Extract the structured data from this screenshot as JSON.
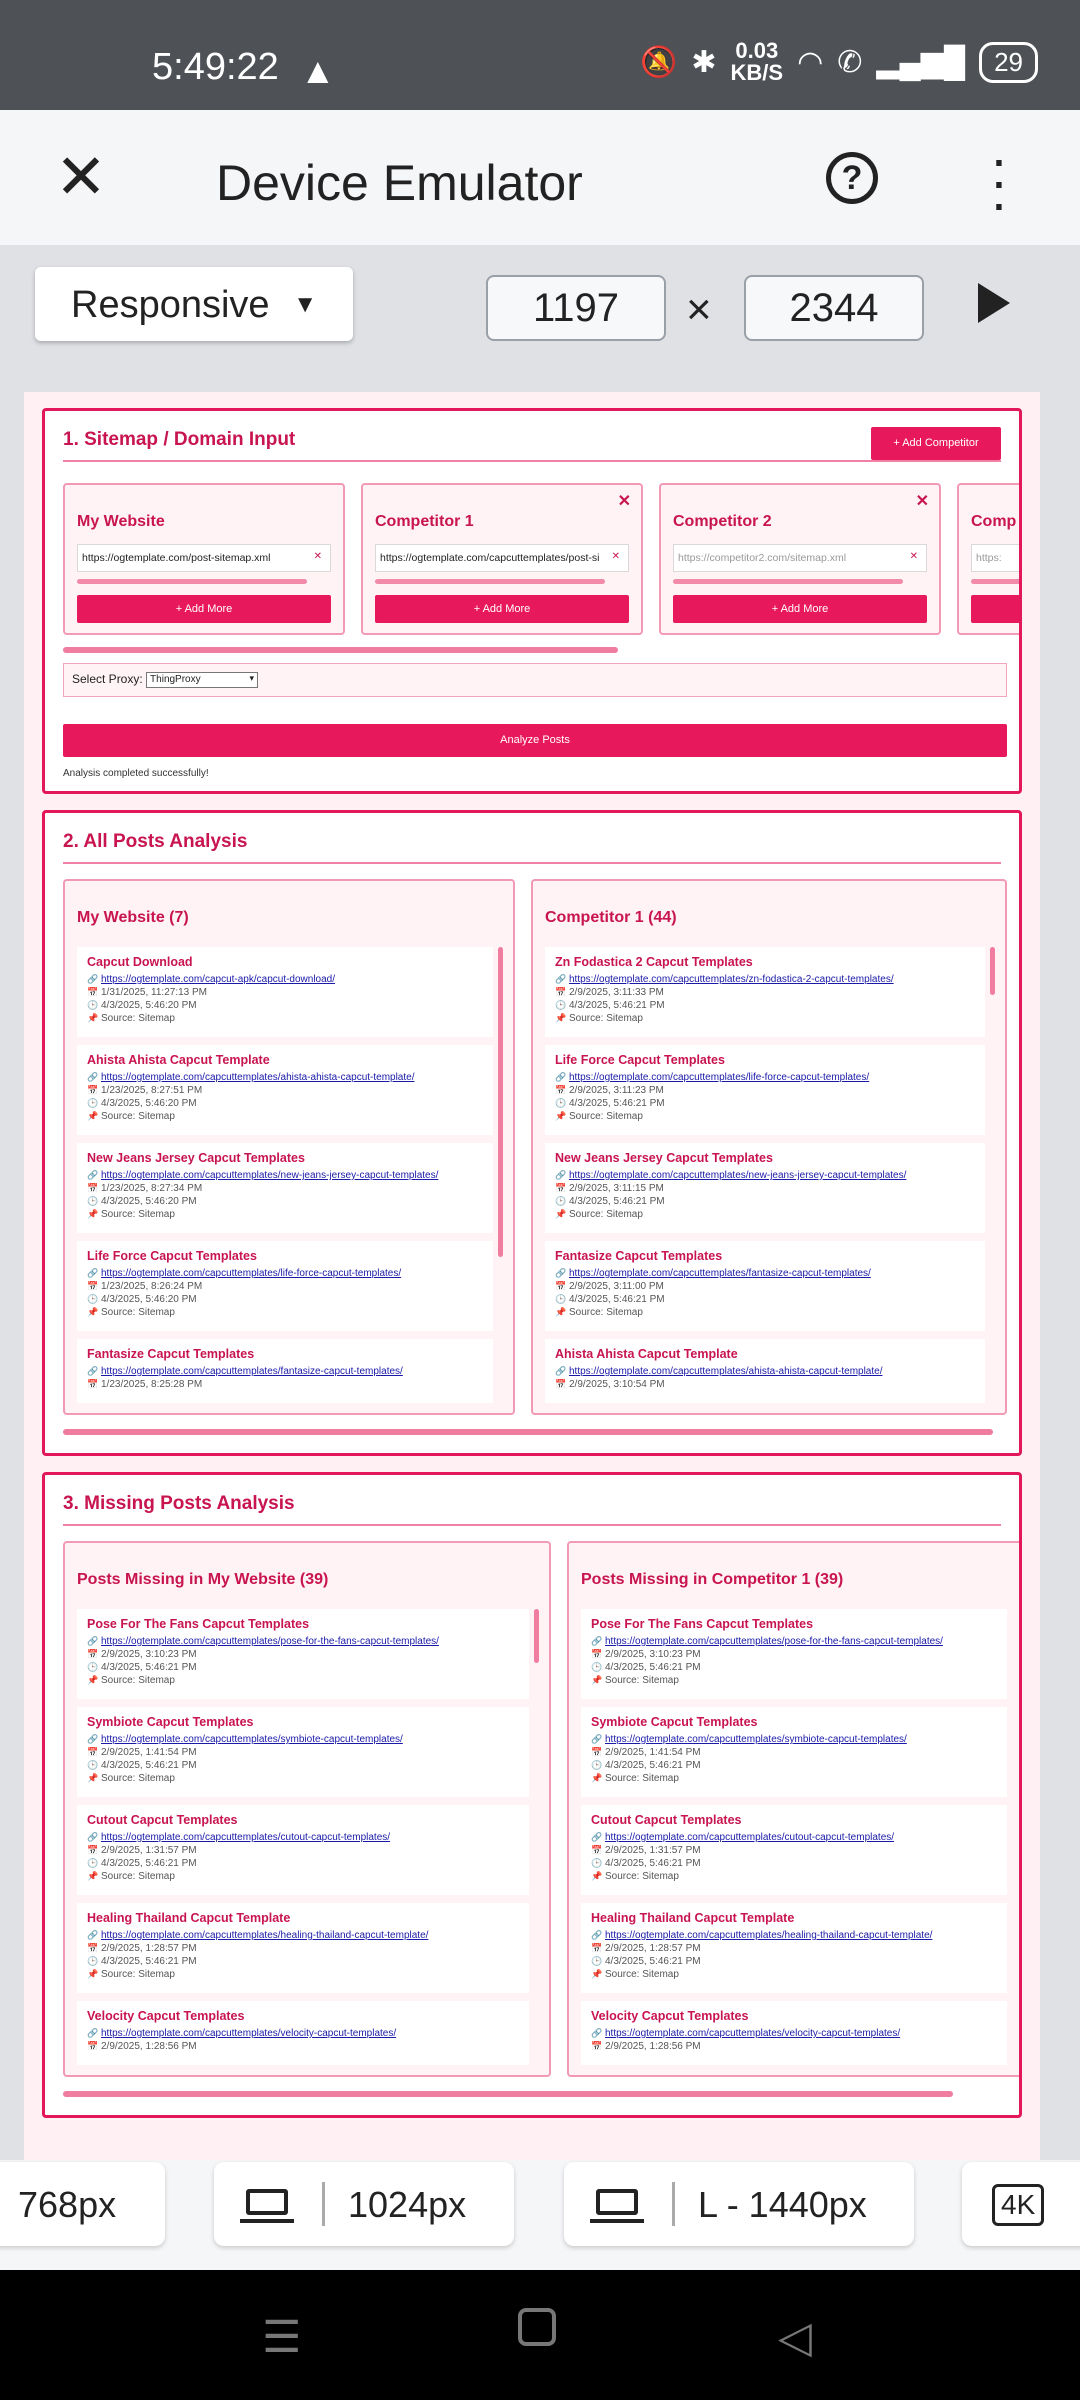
{
  "status_bar": {
    "time": "5:49:22",
    "net_speed": "0.03",
    "net_unit": "KB/S",
    "battery": "29"
  },
  "app_bar": {
    "title": "Device Emulator",
    "help": "?"
  },
  "toolbar": {
    "mode": "Responsive",
    "width": "1197",
    "height": "2344",
    "times": "×"
  },
  "section1": {
    "title": "1. Sitemap / Domain Input",
    "add_competitor": "+ Add Competitor",
    "cards": [
      {
        "title": "My Website",
        "value": "https://ogtemplate.com/post-sitemap.xml",
        "button": "+ Add More"
      },
      {
        "title": "Competitor 1",
        "value": "https://ogtemplate.com/capcuttemplates/post-si",
        "button": "+ Add More"
      },
      {
        "title": "Competitor 2",
        "placeholder": "https://competitor2.com/sitemap.xml",
        "button": "+ Add More"
      },
      {
        "title": "Comp",
        "placeholder": "https:",
        "button": ""
      }
    ],
    "proxy_label": "Select Proxy:",
    "proxy_value": "ThingProxy",
    "analyze": "Analyze Posts",
    "message": "Analysis completed successfully!"
  },
  "section2": {
    "title": "2. All Posts Analysis",
    "columns": [
      {
        "title": "My Website (7)",
        "items": [
          {
            "title": "Capcut Download",
            "url": "https://ogtemplate.com/capcut-apk/capcut-download/",
            "date1": "1/31/2025, 11:27:13 PM",
            "date2": "4/3/2025, 5:46:20 PM",
            "source": "Source: Sitemap"
          },
          {
            "title": "Ahista Ahista Capcut Template",
            "url": "https://ogtemplate.com/capcuttemplates/ahista-ahista-capcut-template/",
            "date1": "1/23/2025, 8:27:51 PM",
            "date2": "4/3/2025, 5:46:20 PM",
            "source": "Source: Sitemap"
          },
          {
            "title": "New Jeans Jersey Capcut Templates",
            "url": "https://ogtemplate.com/capcuttemplates/new-jeans-jersey-capcut-templates/",
            "date1": "1/23/2025, 8:27:34 PM",
            "date2": "4/3/2025, 5:46:20 PM",
            "source": "Source: Sitemap"
          },
          {
            "title": "Life Force Capcut Templates",
            "url": "https://ogtemplate.com/capcuttemplates/life-force-capcut-templates/",
            "date1": "1/23/2025, 8:26:24 PM",
            "date2": "4/3/2025, 5:46:20 PM",
            "source": "Source: Sitemap"
          },
          {
            "title": "Fantasize Capcut Templates",
            "url": "https://ogtemplate.com/capcuttemplates/fantasize-capcut-templates/",
            "date1": "1/23/2025, 8:25:28 PM",
            "date2": "",
            "source": ""
          }
        ]
      },
      {
        "title": "Competitor 1 (44)",
        "items": [
          {
            "title": "Zn Fodastica 2 Capcut Templates",
            "url": "https://ogtemplate.com/capcuttemplates/zn-fodastica-2-capcut-templates/",
            "date1": "2/9/2025, 3:11:33 PM",
            "date2": "4/3/2025, 5:46:21 PM",
            "source": "Source: Sitemap"
          },
          {
            "title": "Life Force Capcut Templates",
            "url": "https://ogtemplate.com/capcuttemplates/life-force-capcut-templates/",
            "date1": "2/9/2025, 3:11:23 PM",
            "date2": "4/3/2025, 5:46:21 PM",
            "source": "Source: Sitemap"
          },
          {
            "title": "New Jeans Jersey Capcut Templates",
            "url": "https://ogtemplate.com/capcuttemplates/new-jeans-jersey-capcut-templates/",
            "date1": "2/9/2025, 3:11:15 PM",
            "date2": "4/3/2025, 5:46:21 PM",
            "source": "Source: Sitemap"
          },
          {
            "title": "Fantasize Capcut Templates",
            "url": "https://ogtemplate.com/capcuttemplates/fantasize-capcut-templates/",
            "date1": "2/9/2025, 3:11:00 PM",
            "date2": "4/3/2025, 5:46:21 PM",
            "source": "Source: Sitemap"
          },
          {
            "title": "Ahista Ahista Capcut Template",
            "url": "https://ogtemplate.com/capcuttemplates/ahista-ahista-capcut-template/",
            "date1": "2/9/2025, 3:10:54 PM",
            "date2": "",
            "source": ""
          }
        ]
      }
    ]
  },
  "section3": {
    "title": "3. Missing Posts Analysis",
    "columns": [
      {
        "title": "Posts Missing in My Website (39)",
        "items": [
          {
            "title": "Pose For The Fans Capcut Templates",
            "url": "https://ogtemplate.com/capcuttemplates/pose-for-the-fans-capcut-templates/",
            "date1": "2/9/2025, 3:10:23 PM",
            "date2": "4/3/2025, 5:46:21 PM",
            "source": "Source: Sitemap"
          },
          {
            "title": "Symbiote Capcut Templates",
            "url": "https://ogtemplate.com/capcuttemplates/symbiote-capcut-templates/",
            "date1": "2/9/2025, 1:41:54 PM",
            "date2": "4/3/2025, 5:46:21 PM",
            "source": "Source: Sitemap"
          },
          {
            "title": "Cutout Capcut Templates",
            "url": "https://ogtemplate.com/capcuttemplates/cutout-capcut-templates/",
            "date1": "2/9/2025, 1:31:57 PM",
            "date2": "4/3/2025, 5:46:21 PM",
            "source": "Source: Sitemap"
          },
          {
            "title": "Healing Thailand Capcut Template",
            "url": "https://ogtemplate.com/capcuttemplates/healing-thailand-capcut-template/",
            "date1": "2/9/2025, 1:28:57 PM",
            "date2": "4/3/2025, 5:46:21 PM",
            "source": "Source: Sitemap"
          },
          {
            "title": "Velocity Capcut Templates",
            "url": "https://ogtemplate.com/capcuttemplates/velocity-capcut-templates/",
            "date1": "2/9/2025, 1:28:56 PM",
            "date2": "",
            "source": ""
          }
        ]
      },
      {
        "title": "Posts Missing in Competitor 1 (39)",
        "items": [
          {
            "title": "Pose For The Fans Capcut Templates",
            "url": "https://ogtemplate.com/capcuttemplates/pose-for-the-fans-capcut-templates/",
            "date1": "2/9/2025, 3:10:23 PM",
            "date2": "4/3/2025, 5:46:21 PM",
            "source": "Source: Sitemap"
          },
          {
            "title": "Symbiote Capcut Templates",
            "url": "https://ogtemplate.com/capcuttemplates/symbiote-capcut-templates/",
            "date1": "2/9/2025, 1:41:54 PM",
            "date2": "4/3/2025, 5:46:21 PM",
            "source": "Source: Sitemap"
          },
          {
            "title": "Cutout Capcut Templates",
            "url": "https://ogtemplate.com/capcuttemplates/cutout-capcut-templates/",
            "date1": "2/9/2025, 1:31:57 PM",
            "date2": "4/3/2025, 5:46:21 PM",
            "source": "Source: Sitemap"
          },
          {
            "title": "Healing Thailand Capcut Template",
            "url": "https://ogtemplate.com/capcuttemplates/healing-thailand-capcut-template/",
            "date1": "2/9/2025, 1:28:57 PM",
            "date2": "4/3/2025, 5:46:21 PM",
            "source": "Source: Sitemap"
          },
          {
            "title": "Velocity Capcut Templates",
            "url": "https://ogtemplate.com/capcuttemplates/velocity-capcut-templates/",
            "date1": "2/9/2025, 1:28:56 PM",
            "date2": "",
            "source": ""
          }
        ]
      }
    ]
  },
  "device_tabs": [
    {
      "label": "768px"
    },
    {
      "label": "1024px",
      "icon": "laptop-icon"
    },
    {
      "label": "L - 1440px",
      "icon": "laptop-icon"
    },
    {
      "label": "4K"
    }
  ]
}
